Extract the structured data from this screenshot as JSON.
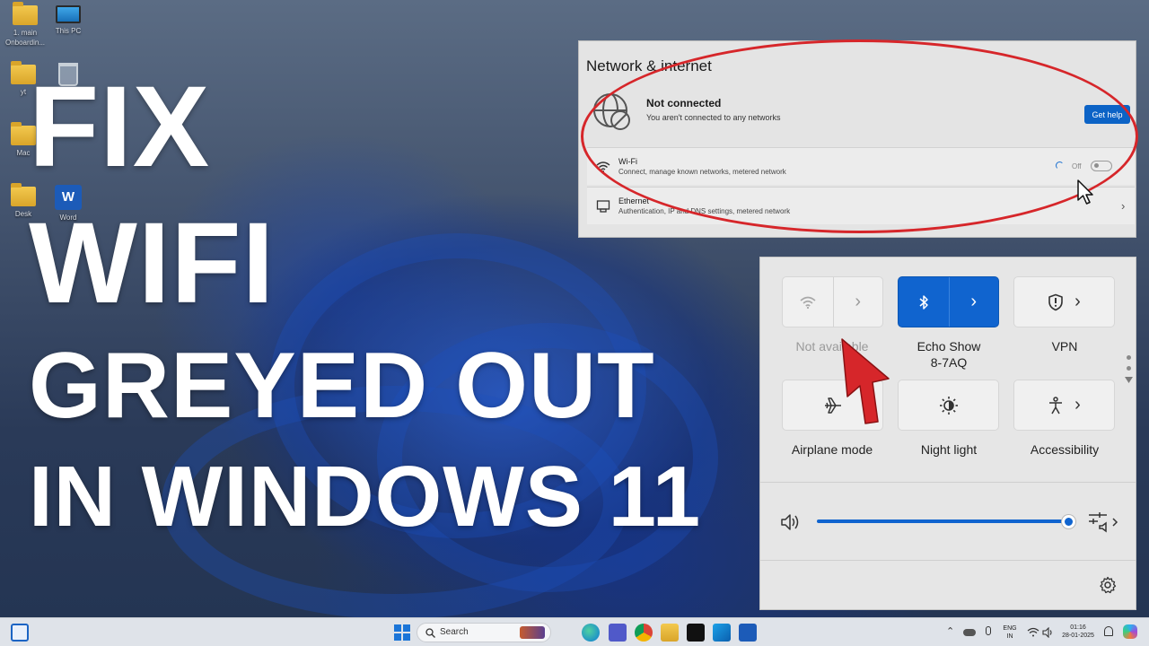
{
  "desktop": {
    "icons": [
      {
        "label": "1. main\nOnboardin...",
        "icon": "folder-icon"
      },
      {
        "label": "This PC",
        "icon": "monitor-icon"
      },
      {
        "label": "yt",
        "icon": "folder-icon"
      },
      {
        "label": "Bin",
        "icon": "recycle-bin-icon"
      },
      {
        "label": "Mac",
        "icon": "folder-icon"
      },
      {
        "label": "Desk",
        "icon": "folder-icon"
      },
      {
        "label": "Word",
        "icon": "word-icon"
      },
      {
        "label": "W",
        "icon": "word-letter"
      }
    ]
  },
  "headline": {
    "line1": "FIX",
    "line2": "WIFI",
    "line3": "GREYED OUT",
    "line4": "IN WINDOWS 11"
  },
  "network_panel": {
    "title": "Network & internet",
    "status_title": "Not connected",
    "status_subtitle": "You aren't connected to any networks",
    "get_help_label": "Get help",
    "rows": [
      {
        "title": "Wi-Fi",
        "subtitle": "Connect, manage known networks, metered network",
        "toggle_label": "Off",
        "icon": "wifi-icon"
      },
      {
        "title": "Ethernet",
        "subtitle": "Authentication, IP and DNS settings, metered network",
        "icon": "ethernet-icon"
      }
    ]
  },
  "quick_settings": {
    "tiles": [
      {
        "label": "Not available",
        "icon": "wifi-icon",
        "state": "disabled"
      },
      {
        "label": "Echo Show\n8-7AQ",
        "icon": "bluetooth-icon",
        "state": "on"
      },
      {
        "label": "VPN",
        "icon": "shield-icon",
        "state": "off"
      },
      {
        "label": "Airplane mode",
        "icon": "airplane-icon",
        "state": "off"
      },
      {
        "label": "Night light",
        "icon": "night-light-icon",
        "state": "off"
      },
      {
        "label": "Accessibility",
        "icon": "accessibility-icon",
        "state": "off"
      }
    ],
    "volume_level": 1.0
  },
  "taskbar": {
    "search_label": "Search",
    "language_line1": "ENG",
    "language_line2": "IN",
    "time": "01:16",
    "date": "28-01-2025"
  },
  "colors": {
    "accent": "#1064cf",
    "annotation_red": "#d6262a",
    "headline_text": "#ffffff"
  }
}
